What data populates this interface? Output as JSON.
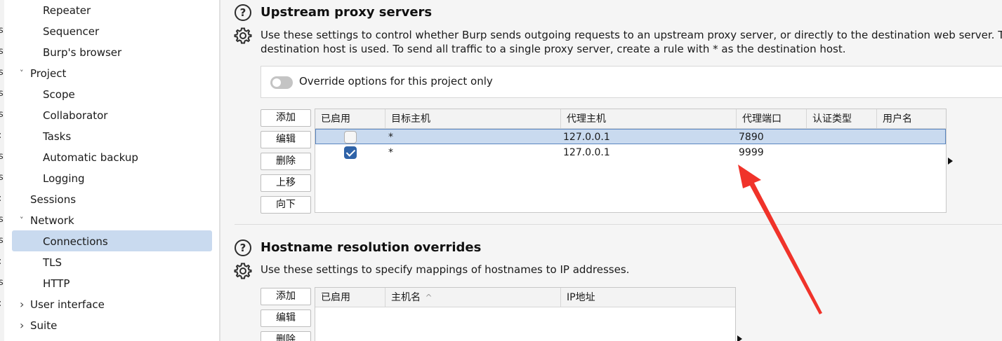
{
  "edge_chars": [
    "s",
    "s",
    "s",
    "s",
    "s",
    ":",
    "s",
    "s",
    ":",
    "s",
    "s",
    ":",
    "s",
    ":"
  ],
  "sidebar": {
    "items": [
      {
        "label": "Repeater",
        "level": 2
      },
      {
        "label": "Sequencer",
        "level": 2
      },
      {
        "label": "Burp's browser",
        "level": 2
      },
      {
        "label": "Project",
        "level": 1,
        "caret": "v"
      },
      {
        "label": "Scope",
        "level": 2
      },
      {
        "label": "Collaborator",
        "level": 2
      },
      {
        "label": "Tasks",
        "level": 2
      },
      {
        "label": "Automatic backup",
        "level": 2
      },
      {
        "label": "Logging",
        "level": 2
      },
      {
        "label": "Sessions",
        "level": 1
      },
      {
        "label": "Network",
        "level": 1,
        "caret": "v"
      },
      {
        "label": "Connections",
        "level": 2,
        "selected": true
      },
      {
        "label": "TLS",
        "level": 2
      },
      {
        "label": "HTTP",
        "level": 2
      },
      {
        "label": "User interface",
        "level": 1,
        "caret": ">"
      },
      {
        "label": "Suite",
        "level": 1,
        "caret": ">"
      }
    ]
  },
  "upstream": {
    "title": "Upstream proxy servers",
    "desc_line1": "Use these settings to control whether Burp sends outgoing requests to an upstream proxy server, or directly to the destination web server. The fi",
    "desc_line2": "destination host is used. To send all traffic to a single proxy server, create a rule with * as the destination host.",
    "override_label": "Override options for this project only",
    "override_enabled": false,
    "buttons": [
      "添加",
      "编辑",
      "删除",
      "上移",
      "向下"
    ],
    "columns": [
      "已启用",
      "目标主机",
      "代理主机",
      "代理端口",
      "认证类型",
      "用户名"
    ],
    "rows": [
      {
        "enabled": false,
        "dest_host": "*",
        "proxy_host": "127.0.0.1",
        "proxy_port": "7890",
        "auth_type": "",
        "username": "",
        "selected": true
      },
      {
        "enabled": true,
        "dest_host": "*",
        "proxy_host": "127.0.0.1",
        "proxy_port": "9999",
        "auth_type": "",
        "username": "",
        "selected": false
      }
    ]
  },
  "hostname": {
    "title": "Hostname resolution overrides",
    "desc": "Use these settings to specify mappings of hostnames to IP addresses.",
    "buttons": [
      "添加",
      "编辑",
      "删除"
    ],
    "columns": [
      "已启用",
      "主机名",
      "IP地址"
    ],
    "sort_indicator": "^"
  },
  "annotation": {
    "color": "#f0332a",
    "icon": "red-arrow"
  },
  "colors": {
    "selection": "#c9daef",
    "checkbox_on": "#2f63a8"
  }
}
